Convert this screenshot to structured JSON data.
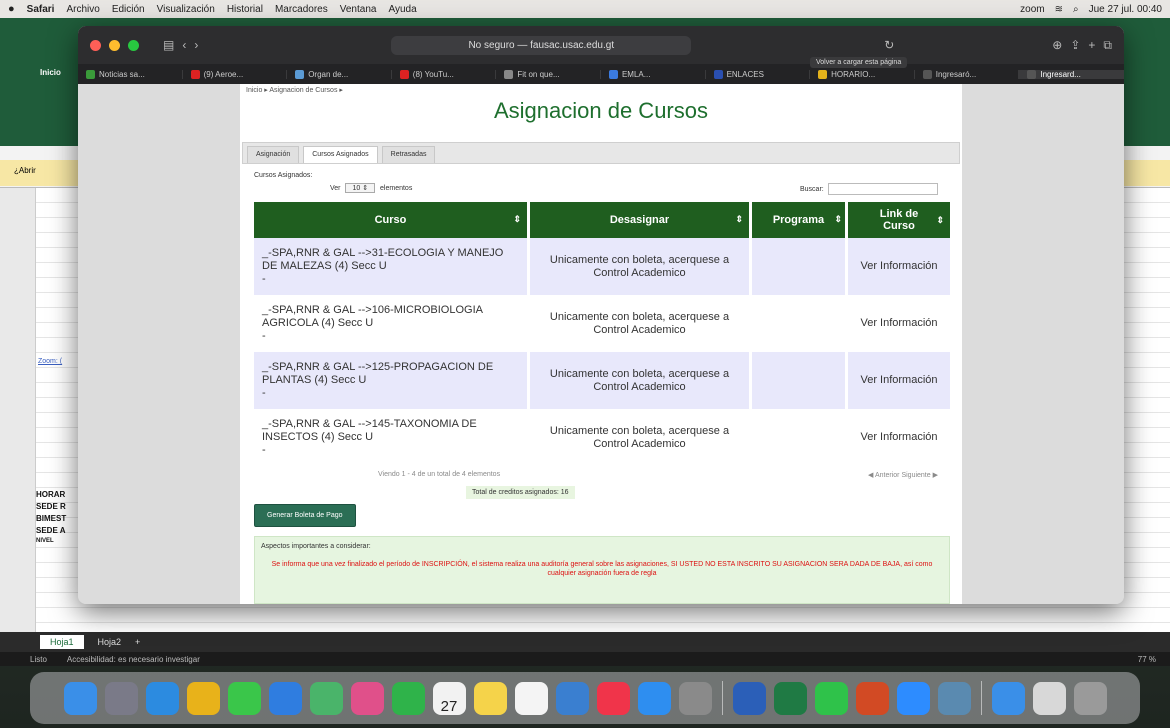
{
  "menubar": {
    "app": "Safari",
    "items": [
      "Archivo",
      "Edición",
      "Visualización",
      "Historial",
      "Marcadores",
      "Ventana",
      "Ayuda"
    ],
    "zoom": "zoom",
    "datetime": "Jue 27 jul. 00:40"
  },
  "excel": {
    "ribbon_tab": "Inicio",
    "yellow_bar": "¿Abrir",
    "sheet_tabs": [
      "Hoja1",
      "Hoja2"
    ],
    "status": "Listo",
    "accessibility": "Accesibilidad: es necesario investigar",
    "zoom": "77 %",
    "side_labels": [
      "HORAR",
      "SEDE R",
      "BIMEST",
      "SEDE A",
      "NIVEL"
    ],
    "zoom_label": "Zoom: ("
  },
  "browser": {
    "address": "No seguro — fausac.usac.edu.gt",
    "tooltip": "Volver a cargar esta página",
    "favorites": [
      {
        "label": "Noticias sa...",
        "color": "#3a9b3a"
      },
      {
        "label": "(9) Aeroe...",
        "color": "#d22"
      },
      {
        "label": "Organ de...",
        "color": "#5b9bd5"
      },
      {
        "label": "(8) YouTu...",
        "color": "#d22"
      },
      {
        "label": "Fit on que...",
        "color": "#888"
      },
      {
        "label": "EMLA...",
        "color": "#3b7be0"
      },
      {
        "label": "ENLACES",
        "color": "#2a4fb0"
      },
      {
        "label": "HORARIO...",
        "color": "#e3b21b"
      },
      {
        "label": "Ingresaró...",
        "color": "#555"
      },
      {
        "label": "Ingresard...",
        "color": "#555"
      }
    ]
  },
  "page": {
    "breadcrumb": "Inicio ▸ Asignacion de Cursos ▸",
    "title": "Asignacion de Cursos",
    "tabs": [
      "Asignación",
      "Cursos Asignados",
      "Retrasadas"
    ],
    "assigned_label": "Cursos Asignados:",
    "show_label": "Ver",
    "show_value": "10",
    "elements_label": "elementos",
    "search_label": "Buscar:",
    "columns": [
      "Curso",
      "Desasignar",
      "Programa",
      "Link de Curso"
    ],
    "rows": [
      {
        "curso": "_-SPA,RNR & GAL -->31-ECOLOGIA Y MANEJO DE MALEZAS (4) Secc U",
        "curso_end": "-",
        "desasignar": "Unicamente con boleta, acerquese a Control Academico",
        "programa": "",
        "link": "Ver Información"
      },
      {
        "curso": "_-SPA,RNR & GAL -->106-MICROBIOLOGIA AGRICOLA (4) Secc U",
        "curso_end": "-",
        "desasignar": "Unicamente con boleta, acerquese a Control Academico",
        "programa": "",
        "link": "Ver Información"
      },
      {
        "curso": "_-SPA,RNR & GAL -->125-PROPAGACION DE PLANTAS (4) Secc U",
        "curso_end": "-",
        "desasignar": "Unicamente con boleta, acerquese a Control Academico",
        "programa": "",
        "link": "Ver Información"
      },
      {
        "curso": "_-SPA,RNR & GAL -->145-TAXONOMIA DE INSECTOS (4) Secc U",
        "curso_end": "-",
        "desasignar": "Unicamente con boleta, acerquese a Control Academico",
        "programa": "",
        "link": "Ver Información"
      }
    ],
    "info": "Viendo 1 - 4 de un total de 4 elementos",
    "prev": "Anterior",
    "next": "Siguiente",
    "total": "Total de creditos asignados: 16",
    "pay_button": "Generar Boleta de Pago",
    "notice_heading": "Aspectos importantes a considerar:",
    "notice_red": "Se informa que una vez finalizado el período de INSCRIPCIÓN, el sistema realiza una auditoría general sobre las asignaciones, SI USTED NO ESTA INSCRITO SU ASIGNACION SERA DADA DE BAJA, así como cualquier asignación fuera de regla"
  },
  "colors": {
    "header_green": "#1f5e1f",
    "title_green": "#1e6f2e",
    "row_alt": "#e8e8fb",
    "button": "#2b6e55"
  },
  "dock": {
    "apps": [
      {
        "name": "finder-icon",
        "color": "#3a8fe8"
      },
      {
        "name": "launchpad-icon",
        "color": "#7a7a88"
      },
      {
        "name": "safari-icon",
        "color": "#2c8be0"
      },
      {
        "name": "chrome-icon",
        "color": "#e8b21a"
      },
      {
        "name": "messages-icon",
        "color": "#3ac64a"
      },
      {
        "name": "mail-icon",
        "color": "#2f7de0"
      },
      {
        "name": "maps-icon",
        "color": "#4ab46a"
      },
      {
        "name": "photos-icon",
        "color": "#e0508a"
      },
      {
        "name": "facetime-icon",
        "color": "#2fb34a"
      },
      {
        "name": "calendar-icon",
        "color": "#f2f2f2"
      },
      {
        "name": "notes-icon",
        "color": "#f5d34a"
      },
      {
        "name": "reminders-icon",
        "color": "#f4f4f4"
      },
      {
        "name": "preview-icon",
        "color": "#3a7fd0"
      },
      {
        "name": "music-icon",
        "color": "#f0344a"
      },
      {
        "name": "appstore-icon",
        "color": "#2e8ef0"
      },
      {
        "name": "settings-icon",
        "color": "#8a8a8a"
      },
      {
        "name": "word-icon",
        "color": "#2b5fb8"
      },
      {
        "name": "excel-icon",
        "color": "#1f7a44"
      },
      {
        "name": "whatsapp-icon",
        "color": "#2fc24a"
      },
      {
        "name": "powerpoint-icon",
        "color": "#d24a24"
      },
      {
        "name": "zoom-icon",
        "color": "#2d8cff"
      },
      {
        "name": "preview2-icon",
        "color": "#5a8ab0"
      },
      {
        "name": "downloads-icon",
        "color": "#3a8fe8"
      },
      {
        "name": "folder-icon",
        "color": "#d8d8d8"
      },
      {
        "name": "trash-icon",
        "color": "#9a9a9a"
      }
    ],
    "calendar_day": "27"
  }
}
